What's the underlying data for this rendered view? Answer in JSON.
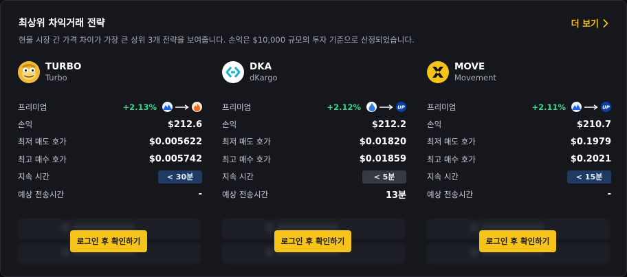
{
  "header": {
    "title": "최상위 차익거래 전략",
    "subtitle": "현물 시장 간 가격 차이가 가장 큰 상위 3개 전략을 보여줍니다. 손익은 $10,000 규모의 투자 기준으로 산정되었습니다.",
    "more_label": "더 보기"
  },
  "labels": {
    "premium": "프리미엄",
    "pnl": "손익",
    "lowest_ask": "최저 매도 호가",
    "highest_bid": "최고 매수 호가",
    "duration": "지속 시간",
    "transfer_time": "예상 전송시간"
  },
  "strategies": [
    {
      "symbol": "TURBO",
      "name": "Turbo",
      "logo_icon": "turbo-frog-icon",
      "premium": "+2.13%",
      "from_exchange_icon": "upbit-mountain-icon",
      "to_exchange_icon": "bithumb-flame-icon",
      "pnl": "$212.6",
      "lowest_ask": "$0.005622",
      "highest_bid": "$0.005742",
      "duration": "< 30분",
      "duration_style": "blue",
      "transfer_time": "-",
      "login_label": "로그인 후 확인하기"
    },
    {
      "symbol": "DKA",
      "name": "dKargo",
      "logo_icon": "dkargo-icon",
      "premium": "+2.12%",
      "from_exchange_icon": "coinone-drop-icon",
      "to_exchange_icon": "upbit-up-icon",
      "pnl": "$212.2",
      "lowest_ask": "$0.01820",
      "highest_bid": "$0.01859",
      "duration": "< 5분",
      "duration_style": "gray",
      "transfer_time": "13분",
      "login_label": "로그인 후 확인하기"
    },
    {
      "symbol": "MOVE",
      "name": "Movement",
      "logo_icon": "movement-icon",
      "premium": "+2.11%",
      "from_exchange_icon": "upbit-mountain-icon",
      "to_exchange_icon": "upbit-up-icon",
      "pnl": "$210.7",
      "lowest_ask": "$0.1979",
      "highest_bid": "$0.2021",
      "duration": "< 15분",
      "duration_style": "blue",
      "transfer_time": "-",
      "login_label": "로그인 후 확인하기"
    }
  ],
  "colors": {
    "accent": "#f5c31a",
    "positive": "#3dd68c",
    "badge_blue": "#1f3a63",
    "badge_gray": "#343942"
  }
}
